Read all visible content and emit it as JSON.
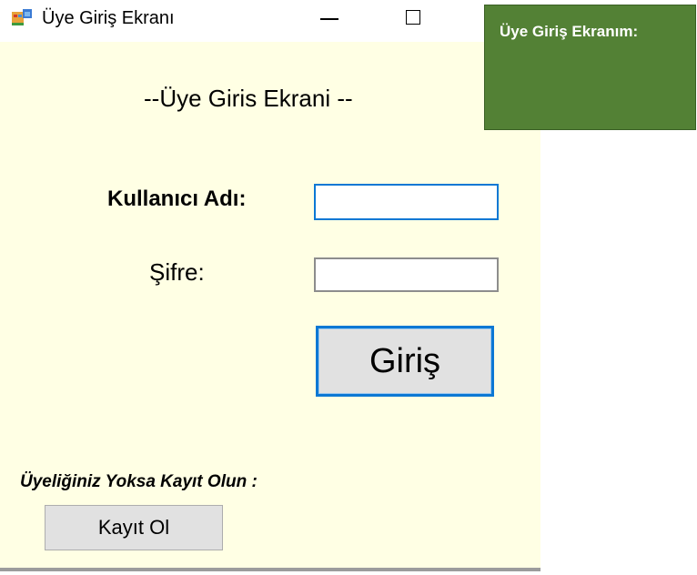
{
  "window": {
    "title": "Üye Giriş Ekranı",
    "icon": "windows-form-icon",
    "controls": {
      "minimize": "minimize-icon",
      "maximize": "maximize-icon"
    }
  },
  "form": {
    "header": "--Üye Giris Ekrani --",
    "username_label": "Kullanıcı Adı:",
    "username_value": "",
    "password_label": "Şifre:",
    "password_value": "",
    "login_button": "Giriş",
    "register_prompt": "Üyeliğiniz Yoksa Kayıt Olun :",
    "register_button": "Kayıt Ol"
  },
  "caption_box": {
    "text": "Üye Giriş Ekranım:"
  },
  "colors": {
    "form_background": "#ffffe4",
    "accent_blue": "#0c78d4",
    "button_gray": "#e1e1e1",
    "caption_green": "#538135"
  }
}
